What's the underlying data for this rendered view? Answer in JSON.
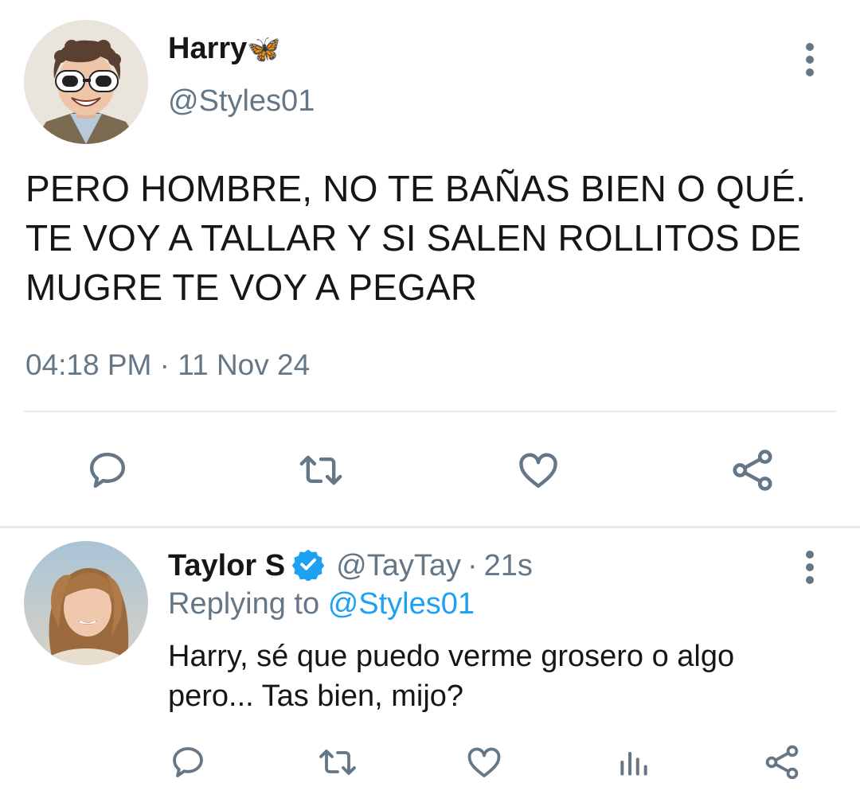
{
  "main_tweet": {
    "author_name": "Harry",
    "author_emoji": "🦋",
    "author_handle": "@Styles01",
    "text": "PERO HOMBRE, NO TE BAÑAS BIEN O QUÉ. TE VOY A TALLAR Y SI SALEN ROLLITOS DE MUGRE TE VOY A PEGAR",
    "time": "04:18 PM",
    "separator": "·",
    "date": "11 Nov 24",
    "actions": [
      "comment-icon",
      "retweet-icon",
      "heart-icon",
      "share-icon"
    ]
  },
  "reply": {
    "author_name": "Taylor S",
    "verified": true,
    "author_handle": "@TayTay",
    "separator": "·",
    "time": "21s",
    "replying_prefix": "Replying to",
    "replying_handle": "@Styles01",
    "text": "Harry, sé que puedo verme grosero o algo pero... Tas bien, mijo?",
    "actions": [
      "comment-icon",
      "retweet-icon",
      "heart-icon",
      "analytics-icon",
      "share-icon"
    ]
  },
  "colors": {
    "text": "#14171a",
    "muted": "#657786",
    "link": "#1da1f2",
    "divider": "#e6ecf0",
    "icon": "#657786",
    "verified": "#1da1f2"
  }
}
